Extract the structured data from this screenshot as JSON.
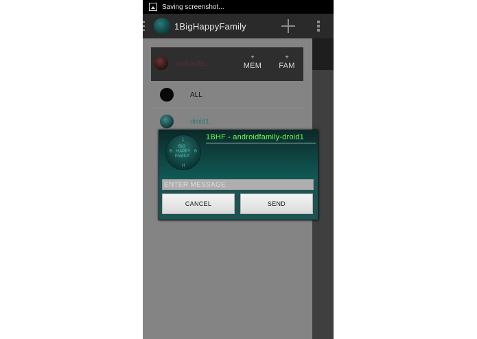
{
  "status_bar": {
    "text": "Saving screenshot..."
  },
  "action_bar": {
    "title": "1BigHappyFamily"
  },
  "drawer": {
    "family_name": "androidfa...",
    "add_member": {
      "plus": "+",
      "label": "MEM"
    },
    "add_family": {
      "plus": "+",
      "label": "FAM"
    },
    "members": [
      {
        "name": "ALL"
      },
      {
        "name": "droid1"
      }
    ]
  },
  "dialog": {
    "title": "1BHF - androidfamily-droid1",
    "logo_text": {
      "top": "1",
      "left": "B",
      "right": "B",
      "line1": "BIG",
      "line2": "HAPPY",
      "line3": "FAMILY",
      "bottom": "H"
    },
    "message_placeholder": "ENTER MESSAGE",
    "cancel_label": "CANCEL",
    "send_label": "SEND"
  },
  "colors": {
    "title_green": "#6cff4b",
    "teal": "#0f5a55",
    "droid_name": "#277a78"
  }
}
